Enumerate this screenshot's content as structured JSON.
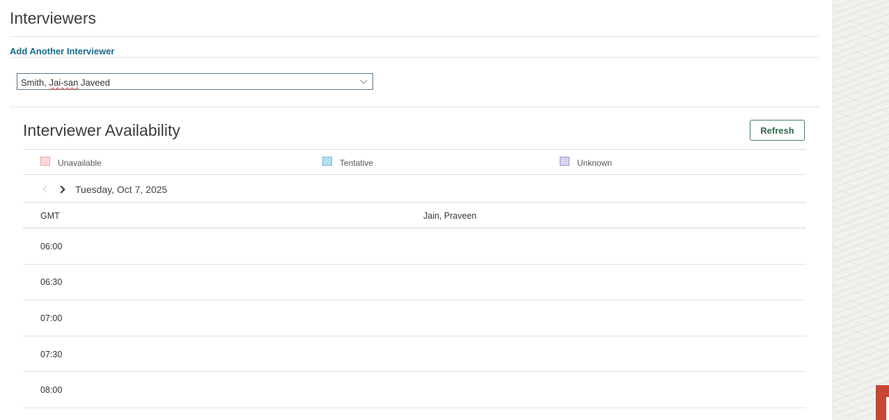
{
  "interviewers": {
    "title": "Interviewers",
    "add_link": "Add Another Interviewer",
    "selected_first": "Smith, ",
    "selected_misspelled": "Jai-san",
    "selected_rest": " Javeed"
  },
  "availability": {
    "title": "Interviewer Availability",
    "refresh_label": "Refresh",
    "legend": [
      {
        "label": "Unavailable",
        "color": "#fcd9da"
      },
      {
        "label": "Tentative",
        "color": "#b3e0f2"
      },
      {
        "label": "Unknown",
        "color": "#d7d3ef"
      }
    ],
    "date": "Tuesday, Oct 7, 2025",
    "timezone_label": "GMT",
    "interviewer_column": "Jain, Praveen",
    "times": [
      "06:00",
      "06:30",
      "07:00",
      "07:30",
      "08:00"
    ]
  },
  "colors": {
    "link": "#166a8a",
    "button_border": "#4d7a62",
    "accent": "#c74634"
  }
}
